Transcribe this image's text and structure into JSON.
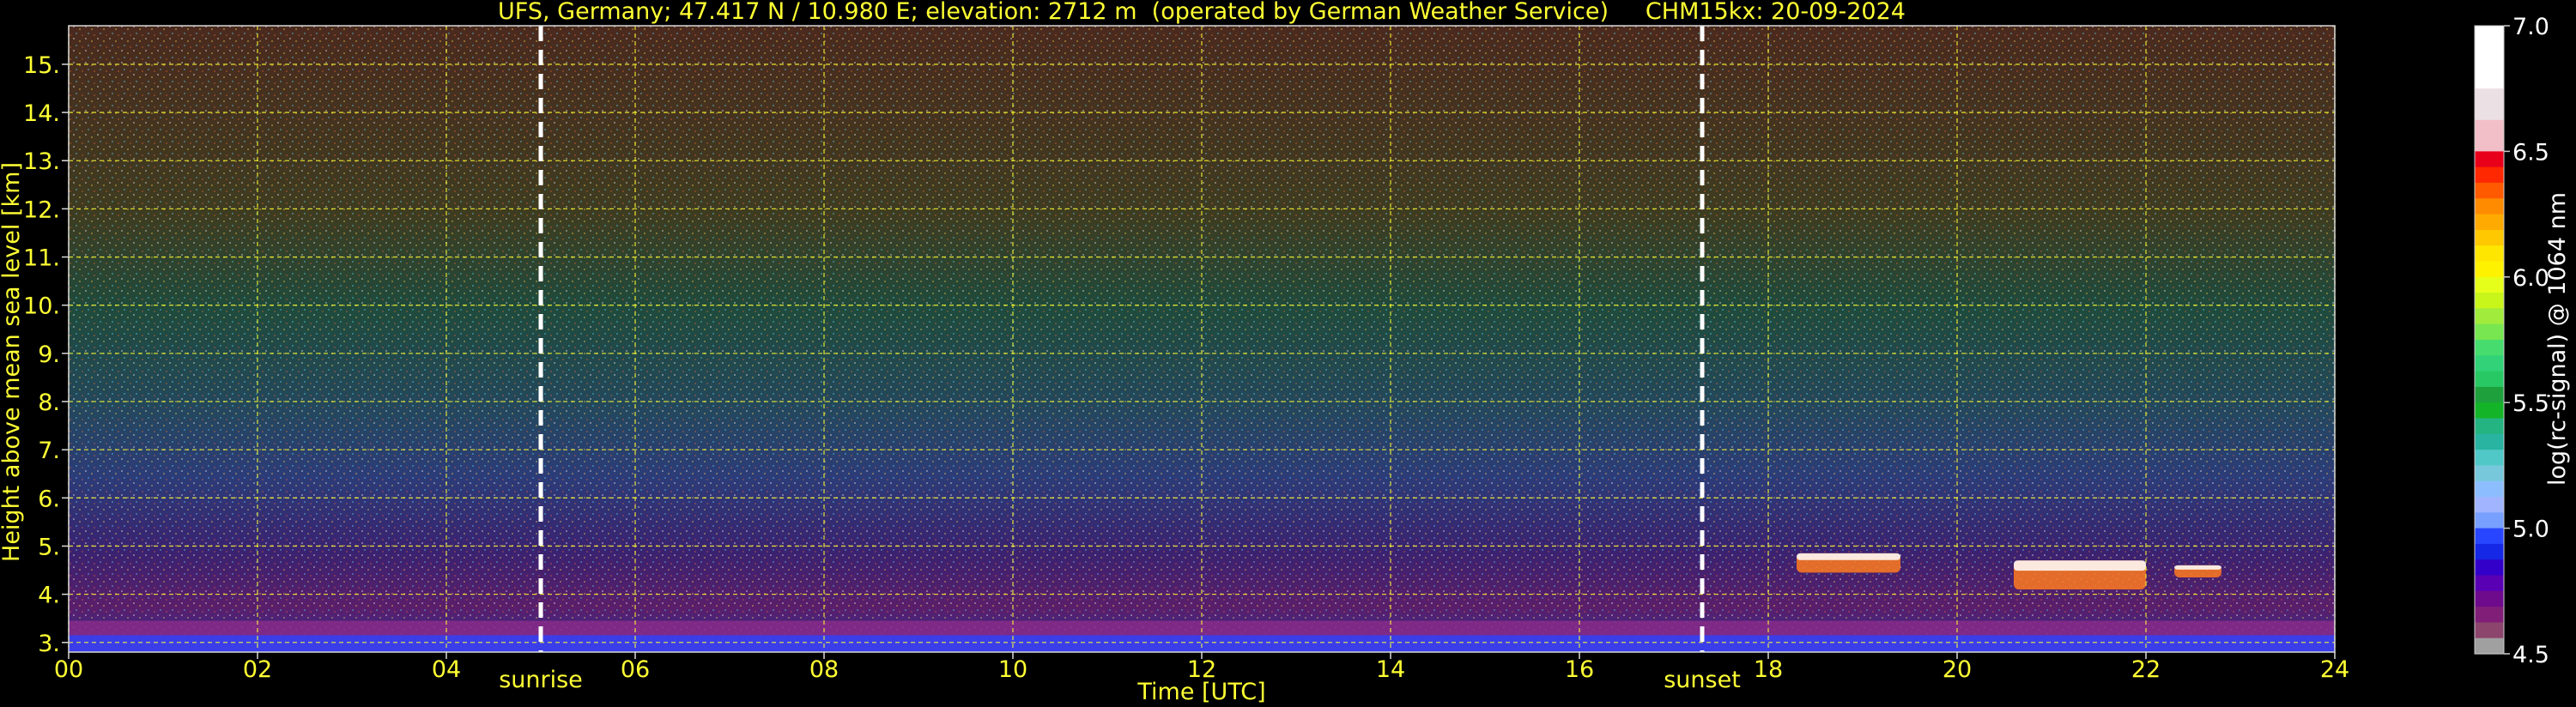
{
  "chart_data": {
    "type": "heatmap",
    "title": "UFS, Germany; 47.417 N / 10.980 E; elevation: 2712 m  (operated by German Weather Service)     CHM15kx: 20-09-2024",
    "xlabel": "Time [UTC]",
    "ylabel": "Height above mean sea level [km]",
    "xlim": [
      0,
      24
    ],
    "ylim": [
      2.8,
      15.8
    ],
    "x_ticks": [
      "00",
      "02",
      "04",
      "06",
      "08",
      "10",
      "12",
      "14",
      "16",
      "18",
      "20",
      "22",
      "24"
    ],
    "y_ticks": [
      "3.",
      "4.",
      "5.",
      "6.",
      "7.",
      "8.",
      "9.",
      "10.",
      "11.",
      "12.",
      "13.",
      "14.",
      "15."
    ],
    "grid": true,
    "markers": [
      {
        "label": "sunrise",
        "x": 5.0
      },
      {
        "label": "sunset",
        "x": 17.3
      }
    ],
    "colorbar": {
      "label": "log(rc-signal) @ 1064 nm",
      "min": 4.5,
      "max": 7.0,
      "ticks": [
        "7.0",
        "6.5",
        "6.0",
        "5.5",
        "5.0",
        "4.5"
      ],
      "colors": [
        "#ffffff",
        "#ffffff",
        "#ffffff",
        "#ffffff",
        "#ebe0e4",
        "#ebe0e4",
        "#f2bfc8",
        "#f2bfc8",
        "#e8001a",
        "#ff2800",
        "#ff5a00",
        "#ff8c00",
        "#ffaa00",
        "#ffc800",
        "#ffe600",
        "#fff200",
        "#e6ff1a",
        "#c8f51a",
        "#a0eb3c",
        "#78e650",
        "#46dc6e",
        "#32d278",
        "#28c864",
        "#1ea03c",
        "#14b428",
        "#23b482",
        "#28b4a0",
        "#50c8c8",
        "#78c8dc",
        "#8cbeff",
        "#a0b4ff",
        "#78a0ff",
        "#2846ff",
        "#1428e6",
        "#3200c8",
        "#5a00b4",
        "#6e0a8c",
        "#801e78",
        "#8c466e",
        "#a0a0a0"
      ]
    },
    "data_description_levels": {
      "boundary_layer_top_km": 3.45,
      "cloud_layers": [
        {
          "x_start": 18.3,
          "x_end": 19.4,
          "base_km": 4.45,
          "top_km": 4.85
        },
        {
          "x_start": 20.6,
          "x_end": 22.0,
          "base_km": 4.1,
          "top_km": 4.7
        },
        {
          "x_start": 22.3,
          "x_end": 22.8,
          "base_km": 4.35,
          "top_km": 4.6
        }
      ]
    }
  }
}
